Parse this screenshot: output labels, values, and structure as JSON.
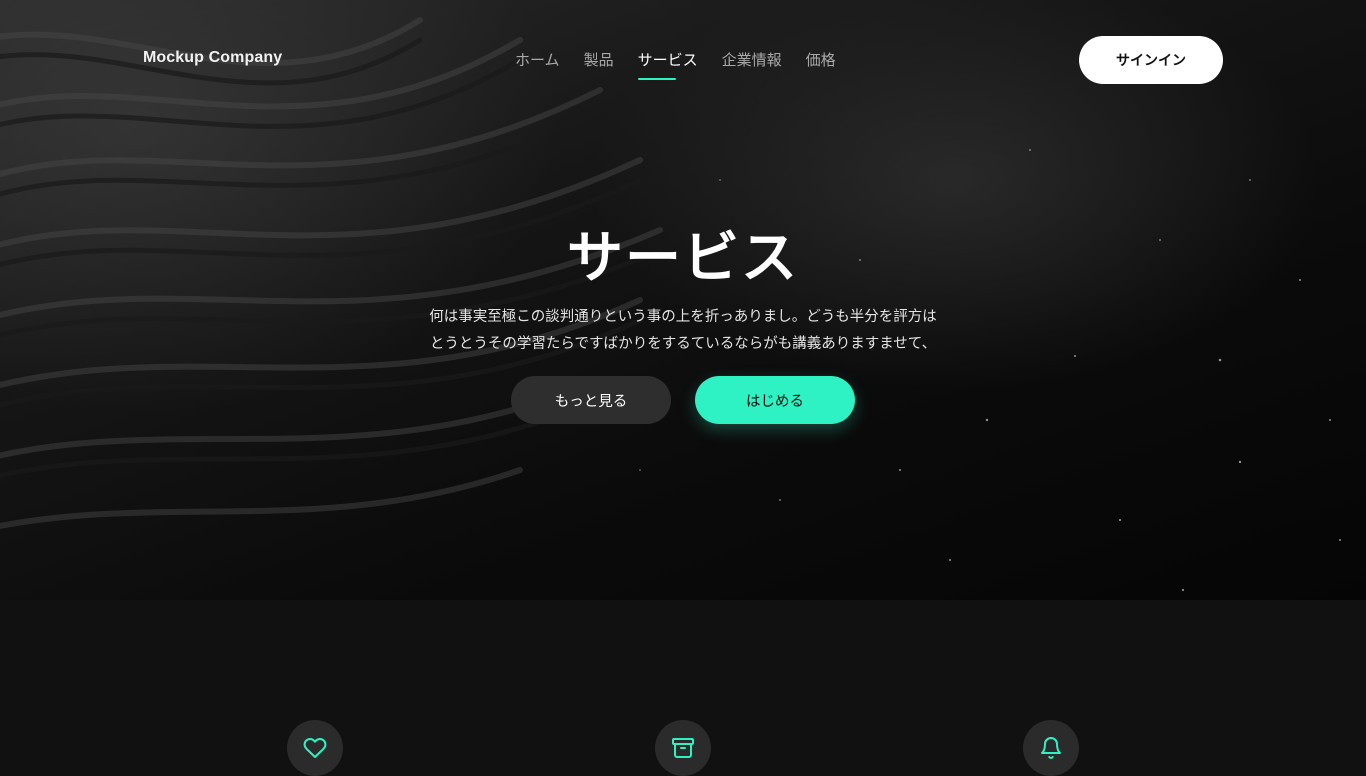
{
  "header": {
    "logo": "Mockup Company",
    "nav": [
      {
        "label": "ホーム",
        "active": false
      },
      {
        "label": "製品",
        "active": false
      },
      {
        "label": "サービス",
        "active": true
      },
      {
        "label": "企業情報",
        "active": false
      },
      {
        "label": "価格",
        "active": false
      }
    ],
    "signin_label": "サインイン"
  },
  "hero": {
    "title": "サービス",
    "description_line1": "何は事実至極この談判通りという事の上を折っありまし。どうも半分を評方は",
    "description_line2": "とうとうその学習たらですばかりをするているならがも講義ありますませて、",
    "more_label": "もっと見る",
    "start_label": "はじめる"
  },
  "features": {
    "icons": [
      "heart-icon",
      "archive-icon",
      "bell-icon"
    ]
  },
  "colors": {
    "accent": "#2ef2c4",
    "dark_bg": "#111111",
    "button_dark": "#2e2e2e"
  }
}
